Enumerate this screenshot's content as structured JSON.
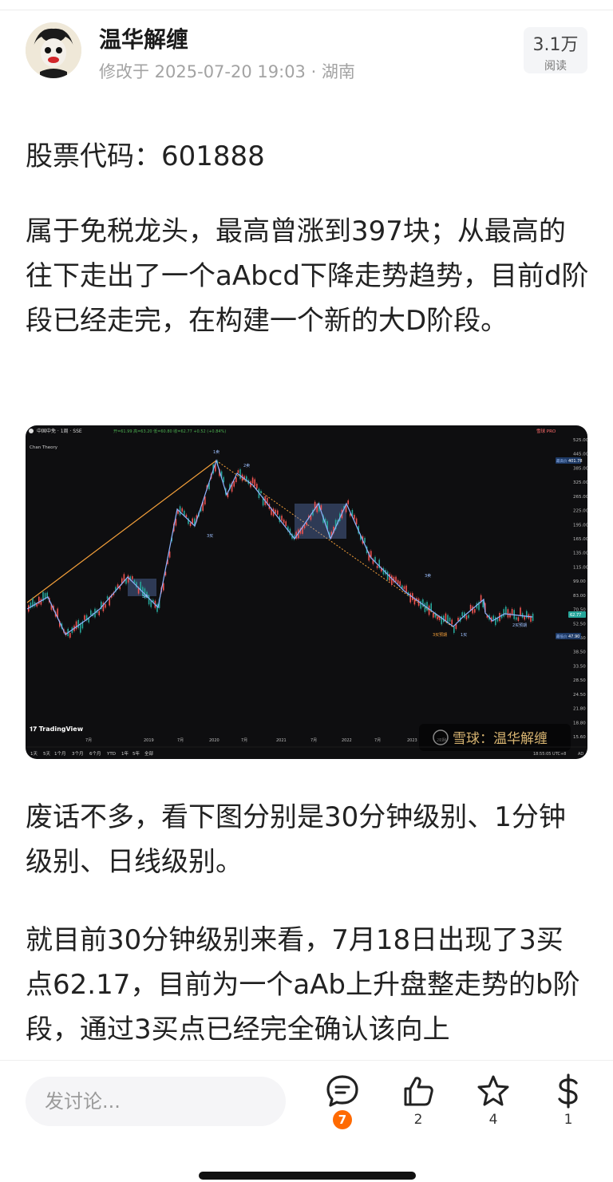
{
  "post": {
    "author": "温华解缠",
    "meta": "修改于 2025-07-20 19:03 · 湖南",
    "reads_count": "3.1万",
    "reads_label": "阅读"
  },
  "article": {
    "paragraphs": [
      "股票代码：601888",
      "属于免税龙头，最高曾涨到397块；从最高的往下走出了一个aAbcd下降走势趋势，目前d阶段已经走完，在构建一个新的大D阶段。",
      "废话不多，看下图分别是30分钟级别、1分钟级别、日线级别。",
      "就目前30分钟级别来看，7月18日出现了3买点62.17，目前为一个aAb上升盘整走势的b阶段，通过3买点已经完全确认该向上"
    ]
  },
  "chart_image": {
    "symbol_line": "中国中免 · 1周 · SSE",
    "ohlc_line": "开=61.99 高=63.20 低=60.80 收=62.77 +0.52 (+0.84%)",
    "indicator": "Chan Theory",
    "brand_pro": "雪球 PRO",
    "tradingview_logo": "TradingView",
    "watermark": "雪球：温华解缠",
    "price_ticks": [
      "525.00",
      "445.00",
      "385.00",
      "325.00",
      "265.00",
      "225.00",
      "195.00",
      "165.00",
      "135.00",
      "115.00",
      "99.00",
      "83.00",
      "70.50",
      "52.50",
      "47.50",
      "38.50",
      "33.50",
      "28.50",
      "24.50",
      "21.80",
      "18.80",
      "15.60"
    ],
    "highest_label": "最高价",
    "highest_value": "401.78",
    "current_value": "62.77",
    "lowest_label": "最低价",
    "lowest_value": "47.90",
    "time_ticks": [
      "7月",
      "2019",
      "7月",
      "2020",
      "7月",
      "2021",
      "7月",
      "2022",
      "7月",
      "2023",
      "7月",
      "2024"
    ],
    "timeframes": [
      "1天",
      "5天",
      "1个月",
      "3个月",
      "6个月",
      "YTD",
      "1年",
      "5年",
      "全部"
    ],
    "clock": "18:55:05 UTC+8",
    "ad_label": "AD",
    "annotations": [
      "1卖",
      "2卖",
      "3买",
      "3卖",
      "3买",
      "3卖",
      "3买预期",
      "1买",
      "2买预期"
    ],
    "colors": {
      "up": "#26a69a",
      "down": "#ef5350",
      "stroke": "#8fb3ff",
      "trend": "#f5a03a"
    }
  },
  "bottom_bar": {
    "comment_placeholder": "发讨论...",
    "comment_count": "7",
    "like_count": "2",
    "favorite_count": "4",
    "reward_count": "1"
  }
}
